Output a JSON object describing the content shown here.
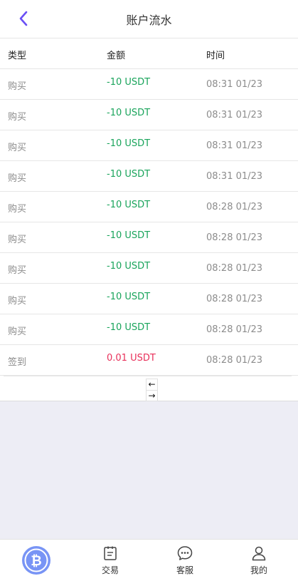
{
  "header": {
    "title": "账户流水"
  },
  "table": {
    "headers": {
      "type": "类型",
      "amount": "金额",
      "time": "时间"
    },
    "rows": [
      {
        "type": "购买",
        "amount": "-10 USDT",
        "time": "08:31 01/23"
      },
      {
        "type": "购买",
        "amount": "-10 USDT",
        "time": "08:31 01/23"
      },
      {
        "type": "购买",
        "amount": "-10 USDT",
        "time": "08:31 01/23"
      },
      {
        "type": "购买",
        "amount": "-10 USDT",
        "time": "08:31 01/23"
      },
      {
        "type": "购买",
        "amount": "-10 USDT",
        "time": "08:28 01/23"
      },
      {
        "type": "购买",
        "amount": "-10 USDT",
        "time": "08:28 01/23"
      },
      {
        "type": "购买",
        "amount": "-10 USDT",
        "time": "08:28 01/23"
      },
      {
        "type": "购买",
        "amount": "-10 USDT",
        "time": "08:28 01/23"
      },
      {
        "type": "购买",
        "amount": "-10 USDT",
        "time": "08:28 01/23"
      },
      {
        "type": "签到",
        "amount": "0.01 USDT",
        "time": "08:28 01/23"
      }
    ]
  },
  "pagination": {
    "prev": "←",
    "next": "→"
  },
  "tabbar": {
    "trade": "交易",
    "service": "客服",
    "mine": "我的"
  },
  "colors": {
    "accent": "#6a4ff5",
    "negative": "#19a45b",
    "positive": "#e8305a",
    "btc_logo": "#6f8ef7"
  },
  "icons": {
    "back": "chevron-left-icon",
    "home": "bitcoin-icon",
    "trade": "clipboard-icon",
    "service": "chat-bubble-icon",
    "mine": "user-icon"
  }
}
